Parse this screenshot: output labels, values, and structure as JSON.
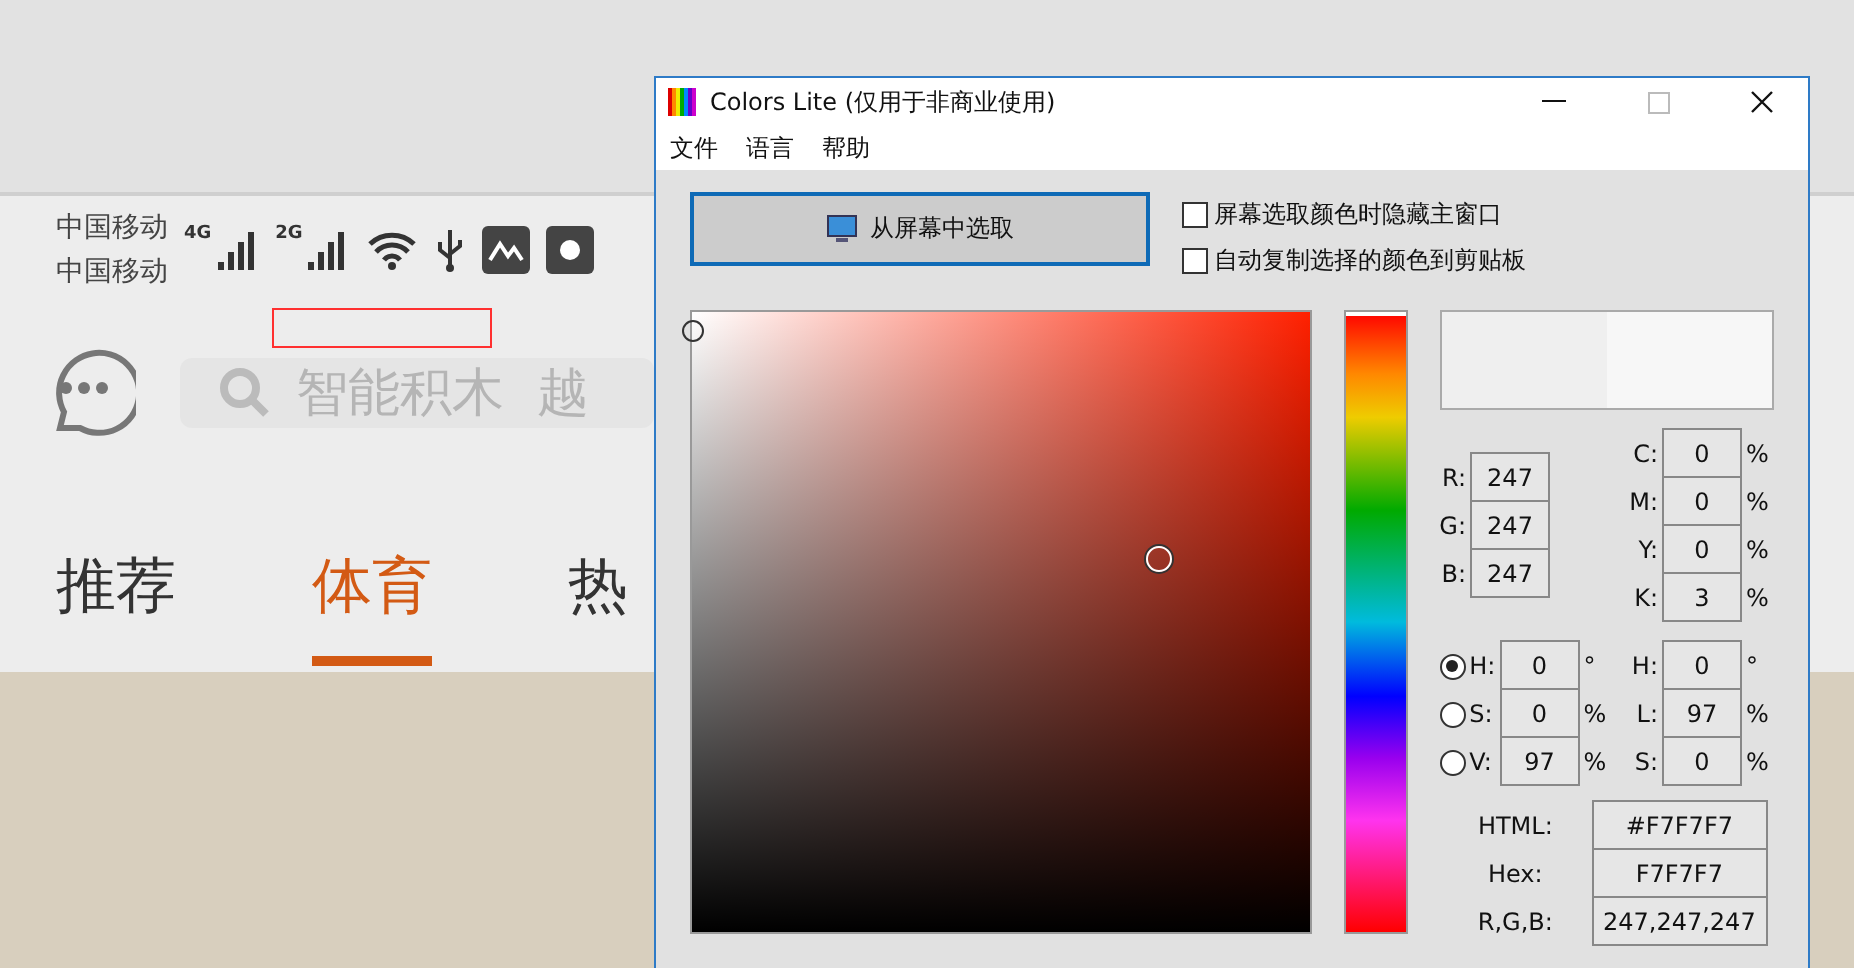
{
  "phone": {
    "carriers": [
      "中国移动",
      "中国移动"
    ],
    "network_labels": [
      "4G",
      "2G"
    ],
    "search": {
      "placeholder": "智能积木  越"
    },
    "tabs": [
      {
        "label": "推荐",
        "selected": false
      },
      {
        "label": "体育",
        "selected": true
      },
      {
        "label": "热",
        "selected": false
      }
    ]
  },
  "window": {
    "title": "Colors Lite (仅用于非商业使用)"
  },
  "menu": [
    "文件",
    "语言",
    "帮助"
  ],
  "pick_button": {
    "label": "从屏幕中选取"
  },
  "options": [
    {
      "label": "屏幕选取颜色时隐藏主窗口",
      "checked": false
    },
    {
      "label": "自动复制选择的颜色到剪贴板",
      "checked": false
    }
  ],
  "picker": {
    "saturation": {
      "level": 0
    },
    "brightness": {
      "level": 0.97
    },
    "hue_slider": {
      "level": 1
    }
  },
  "rgb": [
    {
      "label": "R:",
      "value": "247"
    },
    {
      "label": "G:",
      "value": "247"
    },
    {
      "label": "B:",
      "value": "247"
    }
  ],
  "cmyk": [
    {
      "label": "C:",
      "value": "0",
      "unit": "%"
    },
    {
      "label": "M:",
      "value": "0",
      "unit": "%"
    },
    {
      "label": "Y:",
      "value": "0",
      "unit": "%"
    },
    {
      "label": "K:",
      "value": "3",
      "unit": "%"
    }
  ],
  "hsv": [
    {
      "label": "H:",
      "value": "0",
      "unit": "°",
      "selected": true
    },
    {
      "label": "S:",
      "value": "0",
      "unit": "%",
      "selected": false
    },
    {
      "label": "V:",
      "value": "97",
      "unit": "%",
      "selected": false
    }
  ],
  "hsl": [
    {
      "label": "H:",
      "value": "0",
      "unit": "°"
    },
    {
      "label": "L:",
      "value": "97",
      "unit": "%"
    },
    {
      "label": "S:",
      "value": "0",
      "unit": "%"
    }
  ],
  "codes": [
    {
      "label": "HTML:",
      "value": "#F7F7F7"
    },
    {
      "label": "Hex:",
      "value": "F7F7F7"
    },
    {
      "label": "R,G,B:",
      "value": "247,247,247"
    }
  ]
}
